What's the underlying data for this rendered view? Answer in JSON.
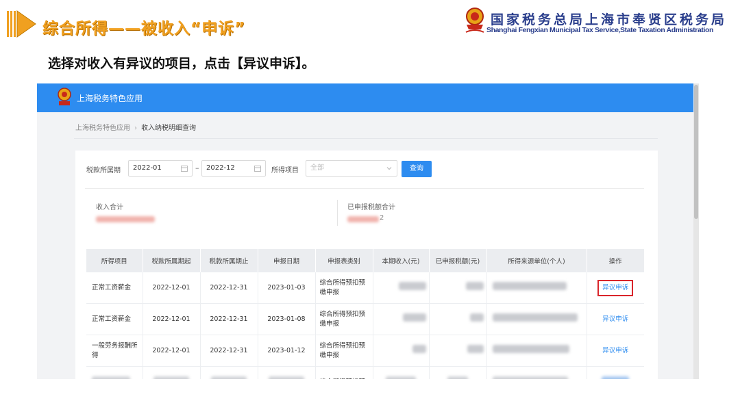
{
  "slide": {
    "title": "综合所得——被收入“申诉”",
    "org_name_cn": "国家税务总局上海市奉贤区税务局",
    "org_name_en": "Shanghai Fengxian Municipal Tax Service,State Taxation Administration",
    "instruction": "选择对收入有异议的项目，点击【异议申诉】。"
  },
  "app": {
    "title": "上海税务特色应用",
    "breadcrumb": [
      "上海税务特色应用",
      "收入纳税明细查询"
    ],
    "breadcrumb_sep": "›"
  },
  "filters": {
    "period_label": "税款所属期",
    "period_start": "2022-01",
    "period_sep": "–",
    "period_end": "2022-12",
    "item_label": "所得项目",
    "item_placeholder": "全部",
    "query_button": "查询"
  },
  "summary": {
    "income_total_label": "收入合计",
    "tax_total_label": "已申报税额合计",
    "tax_total_suffix": "2"
  },
  "table": {
    "headers": [
      "所得项目",
      "税款所属期起",
      "税款所属期止",
      "申报日期",
      "申报表类别",
      "本期收入(元)",
      "已申报税额(元)",
      "所得来源单位(个人)",
      "操作"
    ],
    "rows": [
      {
        "item": "正常工资薪金",
        "start": "2022-12-01",
        "end": "2022-12-31",
        "date": "2023-01-03",
        "category": "综合所得预扣预缴申报",
        "action": "异议申诉",
        "highlighted": true
      },
      {
        "item": "正常工资薪金",
        "start": "2022-12-01",
        "end": "2022-12-31",
        "date": "2023-01-08",
        "category": "综合所得预扣预缴申报",
        "action": "异议申诉",
        "highlighted": false
      },
      {
        "item": "一般劳务报酬所得",
        "start": "2022-12-01",
        "end": "2022-12-31",
        "date": "2023-01-12",
        "category": "综合所得预扣预缴申报",
        "action": "异议申诉",
        "highlighted": false
      },
      {
        "item": "",
        "start": "",
        "end": "",
        "date": "",
        "category": "综合所得预扣预",
        "action": "",
        "highlighted": false
      }
    ]
  },
  "colors": {
    "app_bar": "#2d8cf0",
    "link": "#2d8cf0",
    "highlight": "#d9252b",
    "slide_title": "#f0a020",
    "org_text": "#2a3e8c"
  }
}
